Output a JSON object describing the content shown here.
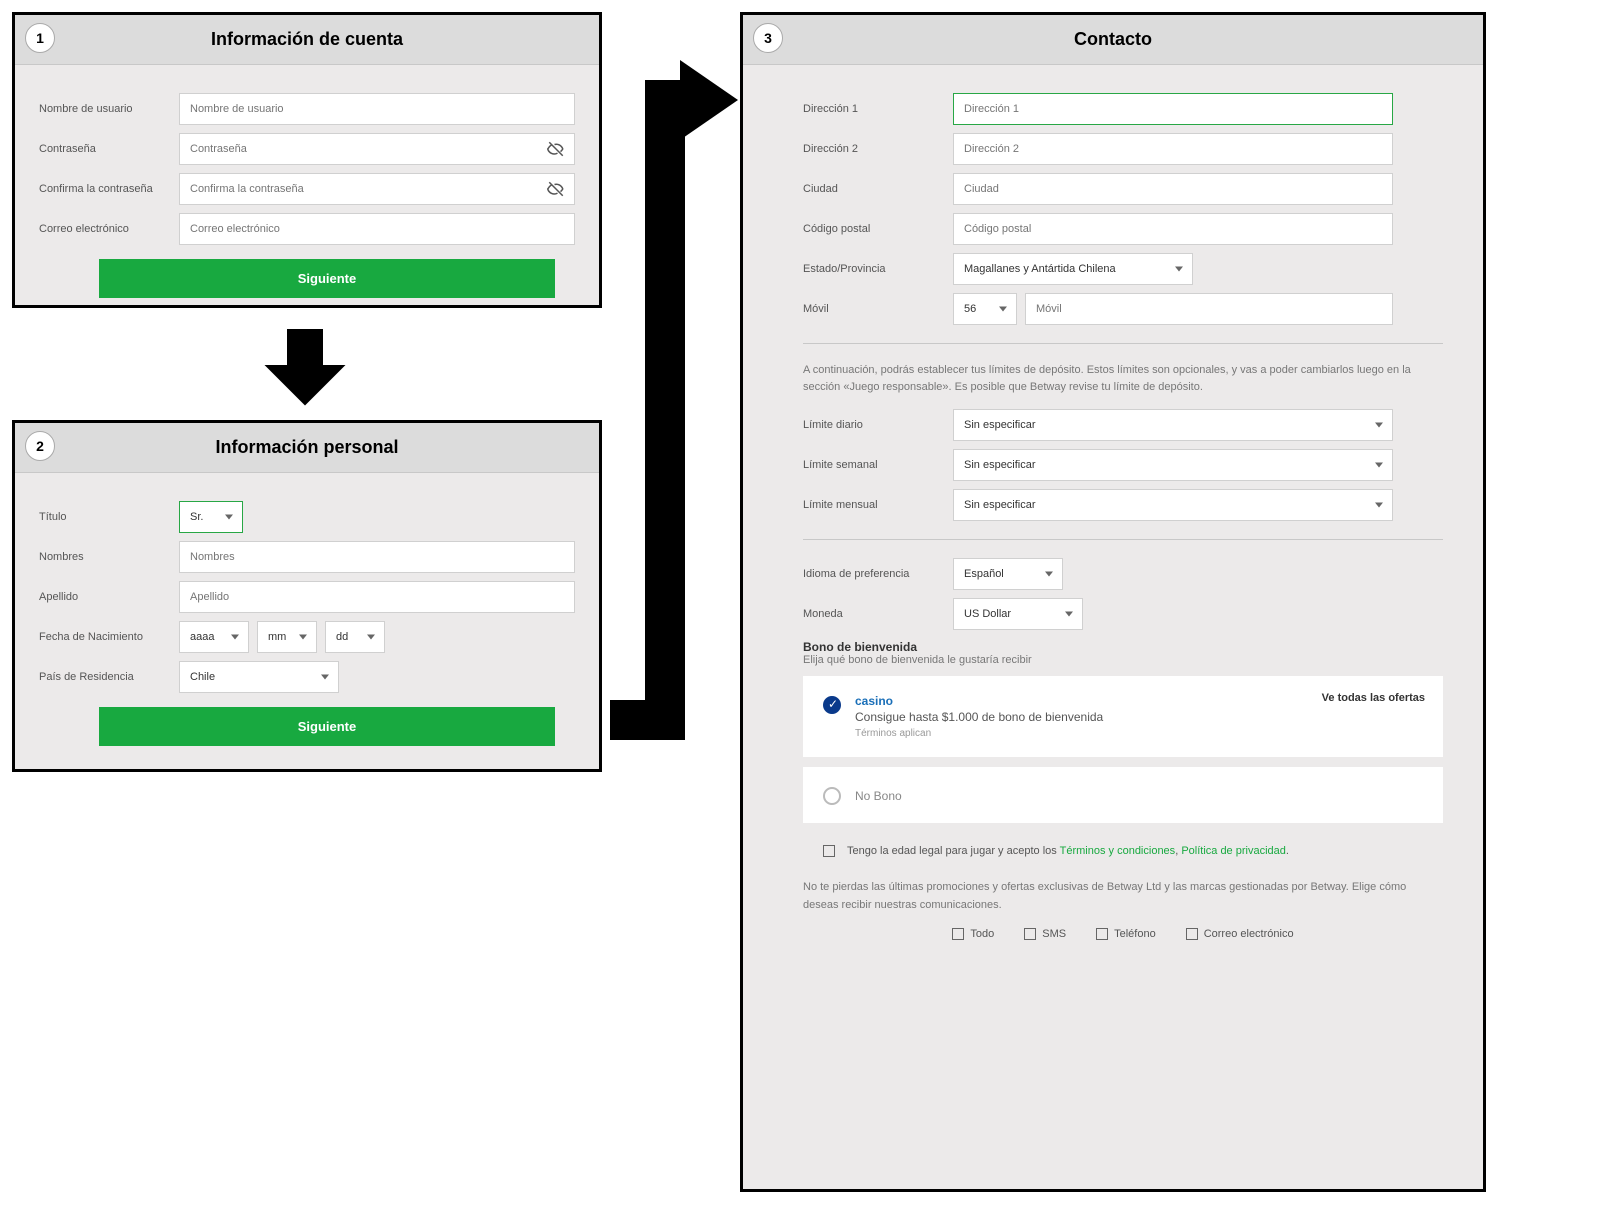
{
  "steps": {
    "one": "1",
    "two": "2",
    "three": "3"
  },
  "panel1": {
    "title": "Información de cuenta",
    "fields": {
      "username_label": "Nombre de usuario",
      "username_ph": "Nombre de usuario",
      "password_label": "Contraseña",
      "password_ph": "Contraseña",
      "confirm_label": "Confirma la contraseña",
      "confirm_ph": "Confirma la contraseña",
      "email_label": "Correo electrónico",
      "email_ph": "Correo electrónico"
    },
    "next": "Siguiente"
  },
  "panel2": {
    "title": "Información personal",
    "fields": {
      "title_label": "Título",
      "title_value": "Sr.",
      "firstname_label": "Nombres",
      "firstname_ph": "Nombres",
      "lastname_label": "Apellido",
      "lastname_ph": "Apellido",
      "dob_label": "Fecha de Nacimiento",
      "year": "aaaa",
      "month": "mm",
      "day": "dd",
      "country_label": "País de Residencia",
      "country_value": "Chile"
    },
    "next": "Siguiente"
  },
  "panel3": {
    "title": "Contacto",
    "fields": {
      "addr1_label": "Dirección 1",
      "addr1_ph": "Dirección 1",
      "addr2_label": "Dirección 2",
      "addr2_ph": "Dirección 2",
      "city_label": "Ciudad",
      "city_ph": "Ciudad",
      "postal_label": "Código postal",
      "postal_ph": "Código postal",
      "state_label": "Estado/Provincia",
      "state_value": "Magallanes y Antártida Chilena",
      "mobile_label": "Móvil",
      "mobile_code": "56",
      "mobile_ph": "Móvil"
    },
    "deposit_info": "A continuación, podrás establecer tus límites de depósito. Estos límites son opcionales, y vas a poder cambiarlos luego en la sección «Juego responsable». Es posible que Betway revise tu límite de depósito.",
    "limits": {
      "daily_label": "Límite diario",
      "weekly_label": "Límite semanal",
      "monthly_label": "Límite mensual",
      "unspecified": "Sin especificar"
    },
    "prefs": {
      "lang_label": "Idioma de preferencia",
      "lang_value": "Español",
      "currency_label": "Moneda",
      "currency_value": "US Dollar"
    },
    "bonus": {
      "title": "Bono de bienvenida",
      "sub": "Elija qué bono de bienvenida le gustaría recibir",
      "casino_name": "casino",
      "casino_desc": "Consigue hasta $1.000 de bono de bienvenida",
      "terms": "Términos aplican",
      "see_all": "Ve todas las ofertas",
      "nobono": "No Bono"
    },
    "legal": {
      "prefix": "Tengo la edad legal para jugar y acepto los ",
      "terms": "Términos y condiciones",
      "sep": ", ",
      "privacy": "Política de privacidad",
      "dot": "."
    },
    "comm": {
      "text": "No te pierdas las últimas promociones y ofertas exclusivas de Betway Ltd y las marcas gestionadas por Betway. Elige cómo deseas recibir nuestras comunicaciones.",
      "all": "Todo",
      "sms": "SMS",
      "phone": "Teléfono",
      "email": "Correo electrónico"
    }
  }
}
